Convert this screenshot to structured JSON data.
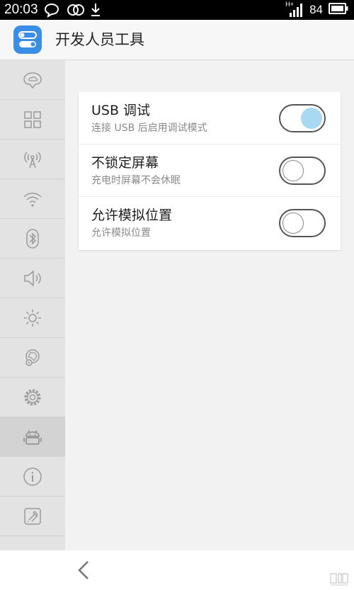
{
  "status_bar": {
    "time": "20:03",
    "network_type": "H+",
    "battery_percent": "84",
    "icons": [
      "chat-bubble-icon",
      "link-rings-icon",
      "download-icon",
      "signal-icon",
      "battery-icon"
    ]
  },
  "app_bar": {
    "title": "开发人员工具",
    "icon": "toggle-settings-icon"
  },
  "sidebar": {
    "items": [
      {
        "icon": "cloud-location-icon"
      },
      {
        "icon": "grid-icon"
      },
      {
        "icon": "antenna-icon"
      },
      {
        "icon": "wifi-icon"
      },
      {
        "icon": "bluetooth-icon"
      },
      {
        "icon": "speaker-icon"
      },
      {
        "icon": "brightness-icon"
      },
      {
        "icon": "location-pin-icon"
      },
      {
        "icon": "gear-icon"
      },
      {
        "icon": "android-icon",
        "active": true
      },
      {
        "icon": "info-icon"
      },
      {
        "icon": "brush-icon"
      }
    ]
  },
  "settings": [
    {
      "title": "USB 调试",
      "subtitle": "连接 USB 后启用调试模式",
      "enabled": true
    },
    {
      "title": "不锁定屏幕",
      "subtitle": "充电时屏幕不会休眠",
      "enabled": false
    },
    {
      "title": "允许模拟位置",
      "subtitle": "允许模拟位置",
      "enabled": false
    }
  ],
  "colors": {
    "accent": "#3a8ee6",
    "toggle_on": "#a9d8f3",
    "sidebar_bg": "#e3e3e3",
    "icon_stroke": "#9a9a9a"
  }
}
